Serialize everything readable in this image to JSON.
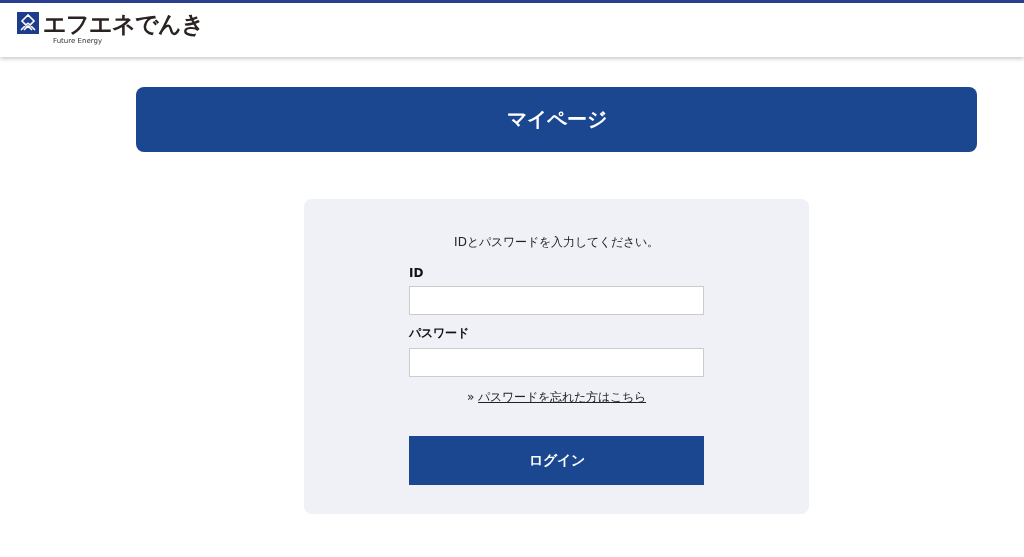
{
  "header": {
    "logo_text": "エフエネでんき",
    "logo_subtext": "Future Energy"
  },
  "banner": {
    "title": "マイページ"
  },
  "login": {
    "instruction": "IDとパスワードを入力してください。",
    "fields": [
      {
        "label": "ID"
      },
      {
        "label": "パスワード"
      }
    ],
    "forgot_link": {
      "marker": "»",
      "label": "パスワードを忘れた方はこちら"
    },
    "submit": "ログイン"
  }
}
